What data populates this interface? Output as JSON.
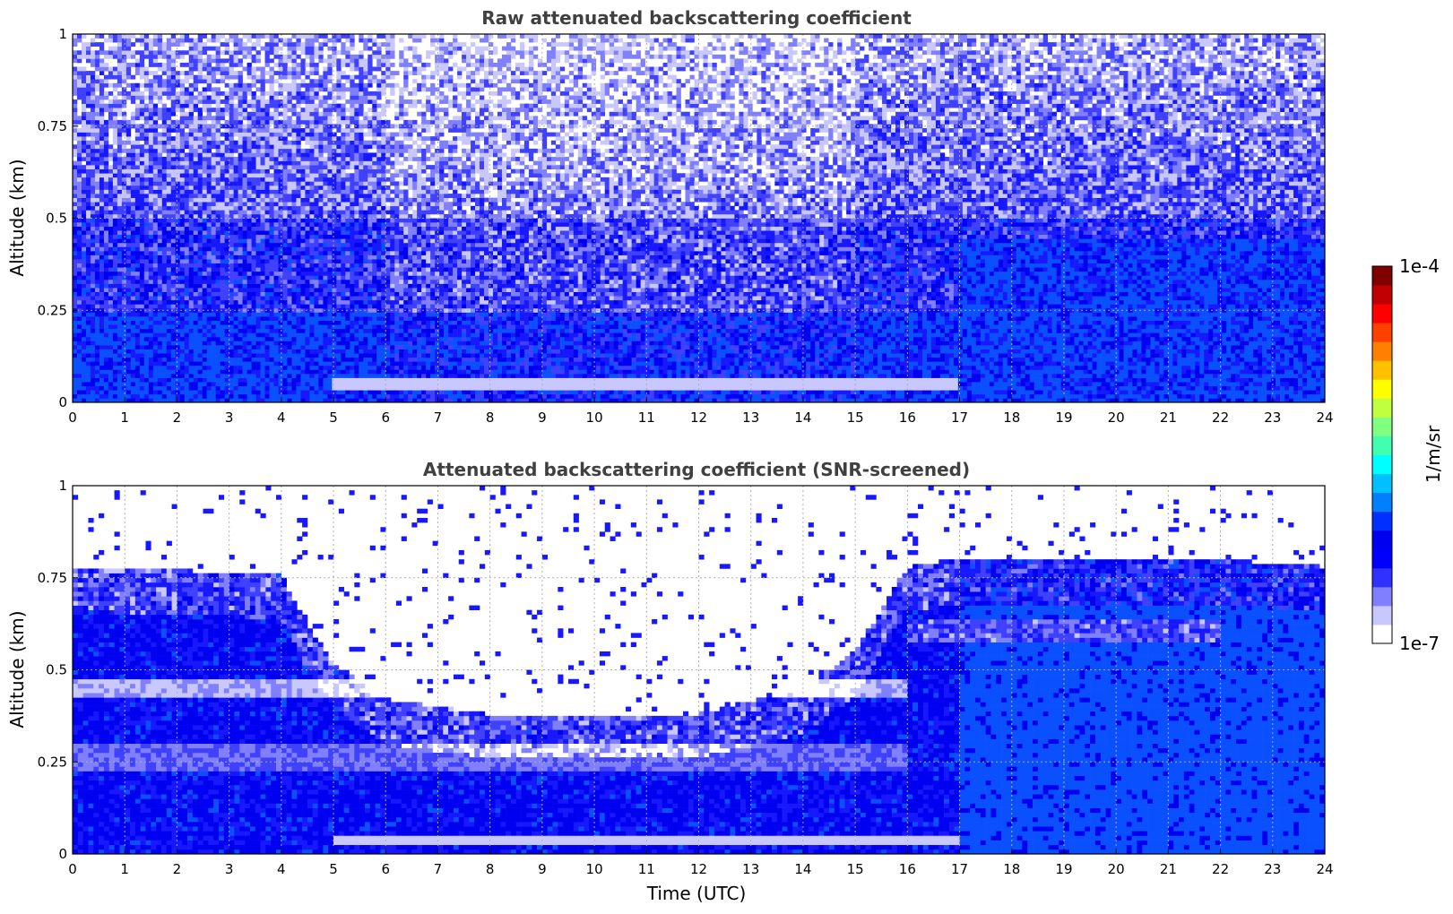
{
  "chart_data": [
    {
      "type": "heatmap",
      "title": "Raw attenuated backscattering coefficient",
      "xlabel": "",
      "ylabel": "Altitude (km)",
      "xlim": [
        0,
        24
      ],
      "ylim": [
        0,
        1
      ],
      "x_ticks": [
        "0",
        "1",
        "2",
        "3",
        "4",
        "5",
        "6",
        "7",
        "8",
        "9",
        "10",
        "11",
        "12",
        "13",
        "14",
        "15",
        "16",
        "17",
        "18",
        "19",
        "20",
        "21",
        "22",
        "23",
        "24"
      ],
      "y_ticks": [
        "0",
        "0.25",
        "0.5",
        "0.75",
        "1"
      ],
      "grid": true,
      "colormap": "jet",
      "color_range": [
        "1e-7",
        "1e-4"
      ],
      "features": {
        "noise_top_km": 1.0,
        "dense_layer_top_km_0_to_17h": 0.25,
        "dense_layer_top_km_17_to_24h": 0.45,
        "bright_layer_km": 0.05
      }
    },
    {
      "type": "heatmap",
      "title": "Attenuated backscattering coefficient (SNR-screened)",
      "xlabel": "Time (UTC)",
      "ylabel": "Altitude (km)",
      "xlim": [
        0,
        24
      ],
      "ylim": [
        0,
        1
      ],
      "x_ticks": [
        "0",
        "1",
        "2",
        "3",
        "4",
        "5",
        "6",
        "7",
        "8",
        "9",
        "10",
        "11",
        "12",
        "13",
        "14",
        "15",
        "16",
        "17",
        "18",
        "19",
        "20",
        "21",
        "22",
        "23",
        "24"
      ],
      "y_ticks": [
        "0",
        "0.25",
        "0.5",
        "0.75",
        "1"
      ],
      "grid": true,
      "colormap": "jet",
      "color_range": [
        "1e-7",
        "1e-4"
      ],
      "boundary_layer_top_km": {
        "hours": [
          0,
          4,
          4.5,
          5,
          6,
          8,
          12,
          14,
          15,
          16,
          17,
          22,
          24
        ],
        "values": [
          0.78,
          0.76,
          0.62,
          0.52,
          0.42,
          0.38,
          0.38,
          0.45,
          0.55,
          0.78,
          0.8,
          0.8,
          0.78
        ]
      }
    }
  ],
  "colorbar": {
    "min_label": "1e-7",
    "max_label": "1e-4",
    "unit_label": "1/m/sr",
    "colors": [
      "#ffffff",
      "#c8c8ff",
      "#8080ff",
      "#3030ff",
      "#0000ff",
      "#0000f0",
      "#0030ff",
      "#0080ff",
      "#00c0ff",
      "#00ffff",
      "#40ffb0",
      "#80ff80",
      "#c0ff40",
      "#ffff00",
      "#ffc000",
      "#ff8000",
      "#ff4000",
      "#ff0000",
      "#c00000",
      "#800000"
    ]
  }
}
